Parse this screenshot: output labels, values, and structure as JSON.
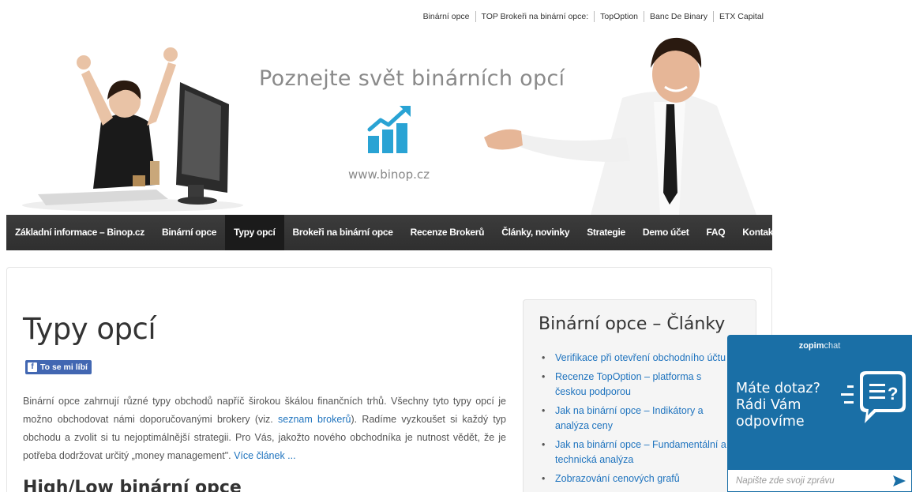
{
  "toplinks": [
    "Binární opce",
    "TOP Brokeři na binární opce:",
    "TopOption",
    "Banc De Binary",
    "ETX Capital"
  ],
  "banner": {
    "tagline": "Poznejte svět binárních opcí",
    "website": "www.binop.cz",
    "logo_color": "#29a3d4"
  },
  "nav": {
    "items": [
      "Základní informace – Binop.cz",
      "Binární opce",
      "Typy opcí",
      "Brokeři na binární opce",
      "Recenze Brokerů",
      "Články, novinky",
      "Strategie",
      "Demo účet",
      "FAQ",
      "Kontakt"
    ],
    "active": "Typy opcí"
  },
  "page": {
    "title": "Typy opcí",
    "like_label": "To se mi líbí",
    "intro_part1": "Binární opce zahrnují různé typy obchodů napříč širokou škálou finančních trhů. Všechny tyto typy opcí je možno obchodovat námi doporučovanými brokery (viz. ",
    "intro_link": "seznam brokerů",
    "intro_part2": "). Radíme vyzkoušet si každý typ obchodu a zvolit si tu nejoptimálnější strategii. Pro Vás, jakožto nového obchodníka je nutnost vědět, že je potřeba dodržovat určitý „money management\". ",
    "more_link": "Více článek ...",
    "subheading": "High/Low binární opce"
  },
  "sidebar": {
    "title": "Binární opce – Články",
    "articles": [
      "Verifikace při otevření obchodního účtu",
      "Recenze TopOption – platforma s českou podporou",
      "Jak na binární opce – Indikátory a analýza ceny",
      "Jak na binární opce – Fundamentální a technická analýza",
      "Zobrazování cenových grafů"
    ]
  },
  "chat": {
    "brand_bold": "zopim",
    "brand_light": "chat",
    "message_line1": "Máte dotaz?",
    "message_line2": "Rádi Vám",
    "message_line3": "odpovíme",
    "placeholder": "Napište zde svoji zprávu",
    "bg_color": "#1a6fa6"
  }
}
